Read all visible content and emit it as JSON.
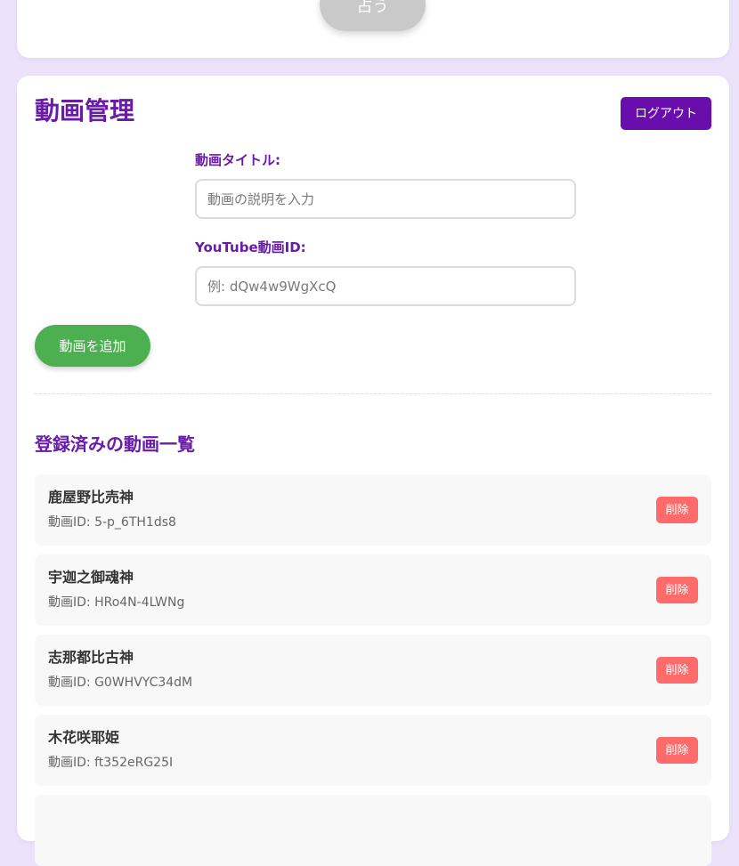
{
  "fortune_section": {
    "button_label": "占う"
  },
  "admin": {
    "title": "動画管理",
    "logout_label": "ログアウト",
    "form": {
      "title_label": "動画タイトル:",
      "title_placeholder": "動画の説明を入力",
      "id_label": "YouTube動画ID:",
      "id_placeholder": "例: dQw4w9WgXcQ",
      "add_label": "動画を追加"
    },
    "list": {
      "heading": "登録済みの動画一覧",
      "id_prefix": "動画ID: ",
      "delete_label": "削除",
      "items": [
        {
          "title": "鹿屋野比売神",
          "video_id": "5-p_6TH1ds8"
        },
        {
          "title": "宇迦之御魂神",
          "video_id": "HRo4N-4LWNg"
        },
        {
          "title": "志那都比古神",
          "video_id": "G0WHVYC34dM"
        },
        {
          "title": "木花咲耶姫",
          "video_id": "ft352eRG25I"
        },
        {
          "title": "",
          "video_id": ""
        }
      ]
    }
  },
  "colors": {
    "page_background": "#ece3fb",
    "accent_purple": "#6a1ba8",
    "logout_purple": "#6a0dad",
    "add_green": "#4caf50",
    "delete_red": "#ff6b6b",
    "disabled_gray": "#c9c9c9"
  }
}
